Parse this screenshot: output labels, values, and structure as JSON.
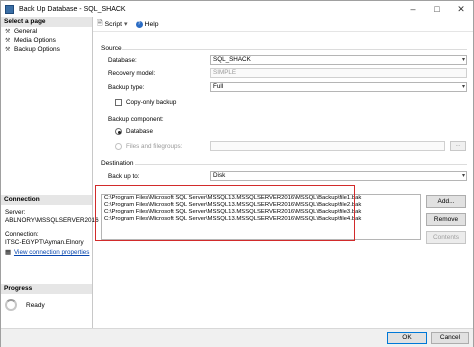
{
  "window": {
    "title": "Back Up Database - SQL_SHACK"
  },
  "left_panel": {
    "header": "Select a page",
    "pages": [
      {
        "label": "General",
        "icon": "wrench-icon"
      },
      {
        "label": "Media Options",
        "icon": "wrench-icon"
      },
      {
        "label": "Backup Options",
        "icon": "wrench-icon"
      }
    ],
    "connection": {
      "header": "Connection",
      "server_label": "Server:",
      "server_value": "ABLNORY\\MSSQLSERVER2016",
      "connection_label": "Connection:",
      "connection_value": "ITSC-EGYPT\\Ayman.Elnory",
      "link": "View connection properties"
    },
    "progress": {
      "header": "Progress",
      "status": "Ready"
    }
  },
  "toolbar": {
    "script_label": "Script",
    "help_label": "Help"
  },
  "source": {
    "section_label": "Source",
    "database_label": "Database:",
    "database_value": "SQL_SHACK",
    "recovery_model_label": "Recovery model:",
    "recovery_model_value": "SIMPLE",
    "backup_type_label": "Backup type:",
    "backup_type_value": "Full",
    "copy_only_label": "Copy-only backup",
    "copy_only_checked": false,
    "backup_component_label": "Backup component:",
    "component_database_label": "Database",
    "component_files_label": "Files and filegroups:",
    "component_selected": "Database",
    "browse_label": "..."
  },
  "destination": {
    "section_label": "Destination",
    "back_up_to_label": "Back up to:",
    "back_up_to_value": "Disk",
    "files": [
      "C:\\Program Files\\Microsoft SQL Server\\MSSQL13.MSSQLSERVER2016\\MSSQL\\Backup\\file1.bak",
      "C:\\Program Files\\Microsoft SQL Server\\MSSQL13.MSSQLSERVER2016\\MSSQL\\Backup\\file2.bak",
      "C:\\Program Files\\Microsoft SQL Server\\MSSQL13.MSSQLSERVER2016\\MSSQL\\Backup\\file3.bak",
      "C:\\Program Files\\Microsoft SQL Server\\MSSQL13.MSSQLSERVER2016\\MSSQL\\Backup\\file4.bak"
    ],
    "add_label": "Add...",
    "remove_label": "Remove",
    "contents_label": "Contents"
  },
  "footer": {
    "ok_label": "OK",
    "cancel_label": "Cancel"
  },
  "colors": {
    "highlight": "#d22b2b",
    "link": "#0645ad",
    "primary_border": "#0078d7"
  }
}
